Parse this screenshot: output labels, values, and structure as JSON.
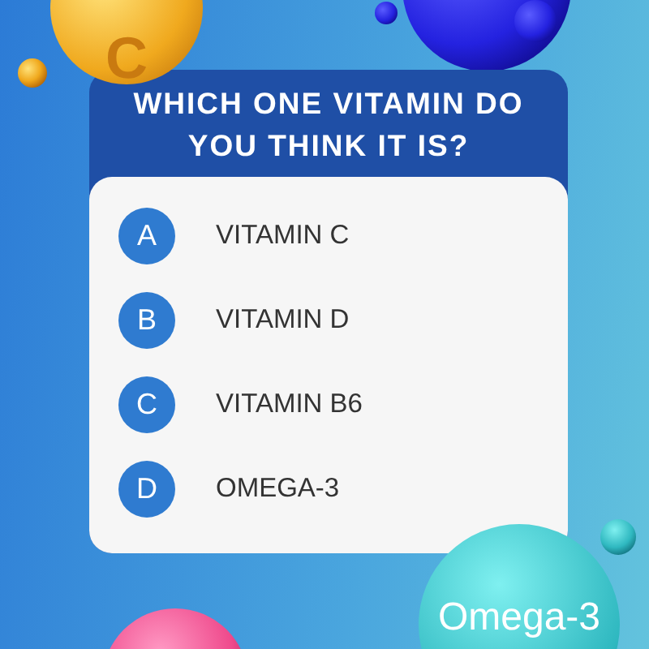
{
  "question": "WHICH ONE VITAMIN DO YOU THINK IT IS?",
  "options": [
    {
      "letter": "A",
      "label": "VITAMIN C"
    },
    {
      "letter": "B",
      "label": "VITAMIN D"
    },
    {
      "letter": "C",
      "label": "VITAMIN B6"
    },
    {
      "letter": "D",
      "label": "OMEGA-3"
    }
  ],
  "decorations": [
    {
      "kind": "gold-ball",
      "label": "C"
    },
    {
      "kind": "teal-ball",
      "label": "Omega-3"
    }
  ]
}
